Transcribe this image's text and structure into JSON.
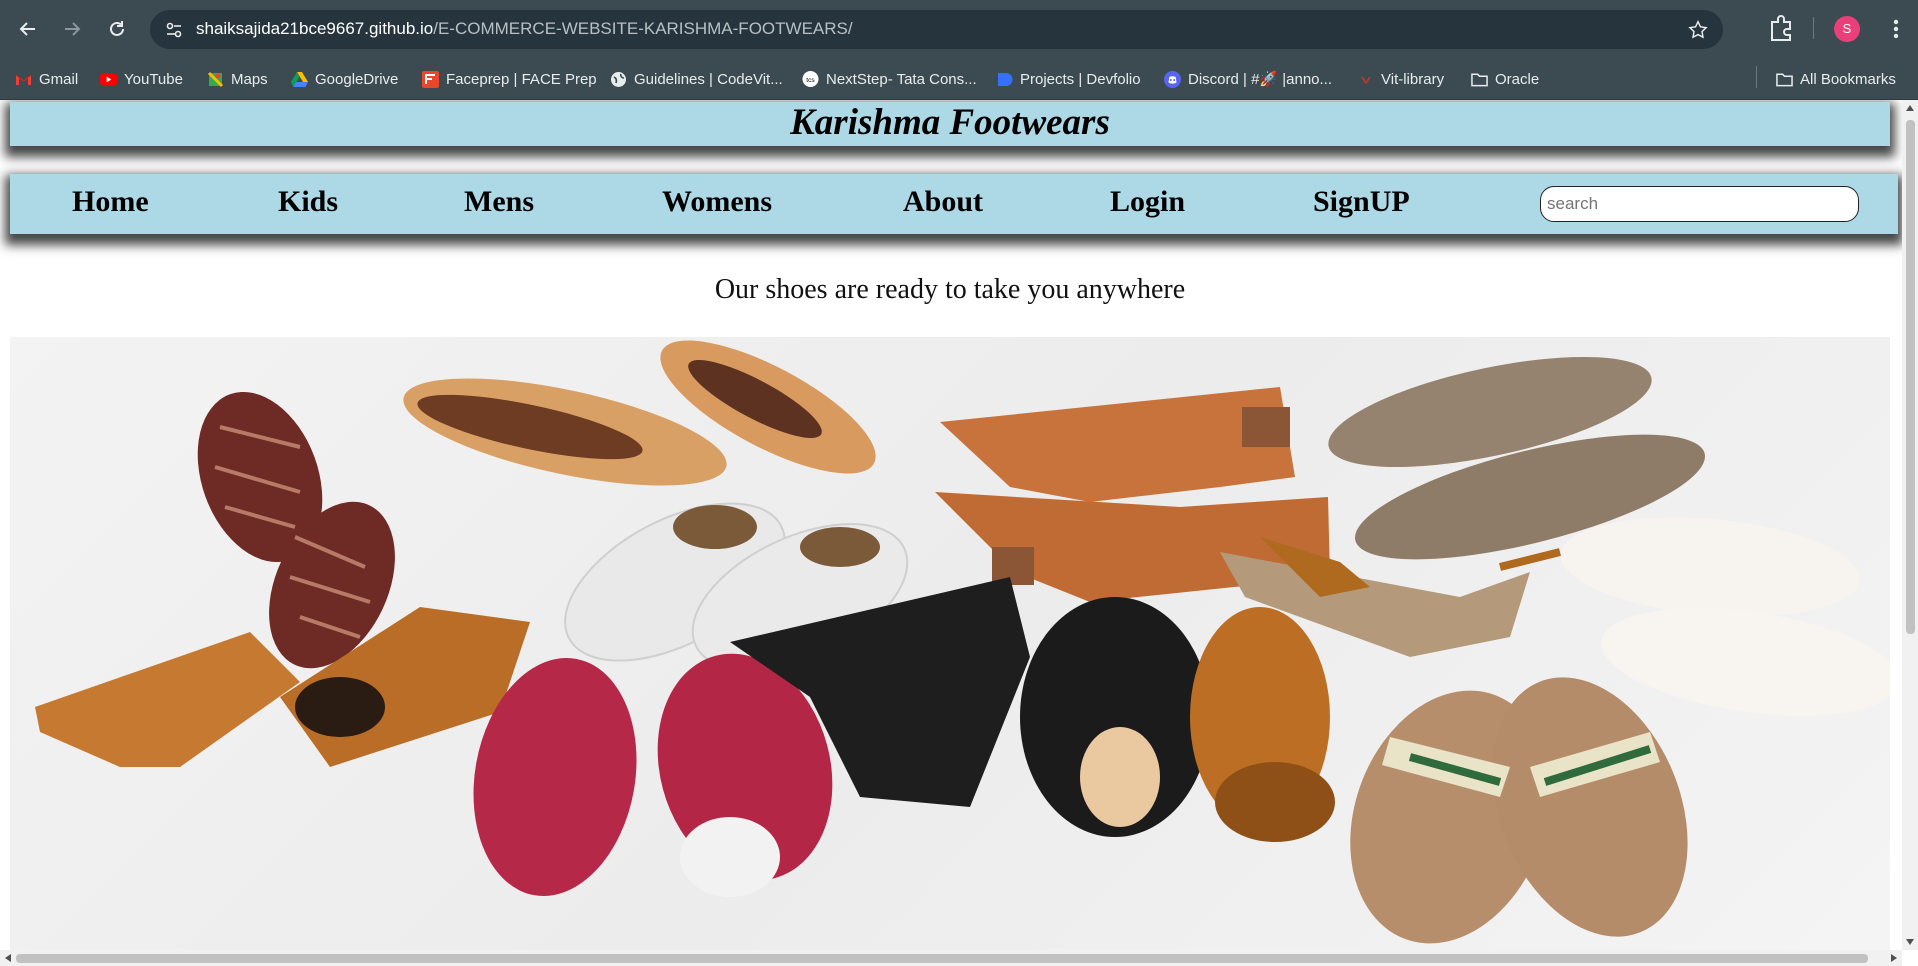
{
  "browser": {
    "url_host": "shaiksajida21bce9667.github.io",
    "url_path": "/E-COMMERCE-WEBSITE-KARISHMA-FOOTWEARS/",
    "profile_initial": "S",
    "bookmarks": [
      {
        "label": "Gmail",
        "icon": "gmail-icon"
      },
      {
        "label": "YouTube",
        "icon": "youtube-icon"
      },
      {
        "label": "Maps",
        "icon": "maps-icon"
      },
      {
        "label": "GoogleDrive",
        "icon": "google-drive-icon"
      },
      {
        "label": "Faceprep | FACE Prep",
        "icon": "faceprep-icon"
      },
      {
        "label": "Guidelines | CodeVit...",
        "icon": "globe-icon"
      },
      {
        "label": "NextStep- Tata Cons...",
        "icon": "tcs-icon"
      },
      {
        "label": "Projects | Devfolio",
        "icon": "devfolio-icon"
      },
      {
        "label": "Discord | #🚀 |anno...",
        "icon": "discord-icon"
      },
      {
        "label": "Vit-library",
        "icon": "vit-icon"
      },
      {
        "label": "Oracle",
        "icon": "folder-icon"
      }
    ],
    "all_bookmarks": "All Bookmarks"
  },
  "site": {
    "title": "Karishma Footwears",
    "nav": [
      "Home",
      "Kids",
      "Mens",
      "Womens",
      "About",
      "Login",
      "SignUP"
    ],
    "search_placeholder": "search",
    "tagline": "Our shoes are ready to take you anywhere",
    "hero_alt": "Assorted shoes laid out on white background"
  },
  "colors": {
    "chrome": "#3c4a52",
    "header_bg": "#add8e6",
    "profile": "#e9407a"
  }
}
